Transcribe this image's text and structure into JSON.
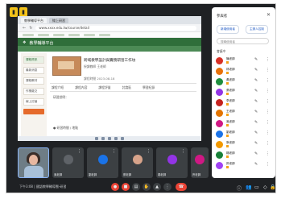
{
  "meet": {
    "bottom_left": "下午3:08 | 國語教學輔導團-研習",
    "controls": [
      "mic-off",
      "cam-off",
      "captions",
      "hand",
      "present",
      "more",
      "end-call"
    ],
    "right_icons": [
      "info",
      "people",
      "chat",
      "activities",
      "lock"
    ]
  },
  "browser": {
    "tabs": [
      "教學輔導平台",
      "線上研習"
    ],
    "url": "www.xxxx.edu.tw/course/detail"
  },
  "site": {
    "header": "教學輔導平台",
    "sidebar": [
      "課程資訊",
      "最新消息",
      "課程教材",
      "作業繳交",
      "線上討論"
    ],
    "course_title": "跨域教學設計與實務研習工作坊",
    "course_sub": "授課教師 王老師",
    "course_meta": "課程時間 2023-08-18",
    "tabs": [
      "課程介紹",
      "課程內容",
      "課程評量",
      "討論區",
      "學習紀錄"
    ],
    "line1": "研習說明：",
    "line2": "● 研習時間 / 地點"
  },
  "panel": {
    "title": "參與者",
    "add_people": "新增使用者",
    "host_controls": "主辦人控制",
    "search_placeholder": "搜尋使用者",
    "section": "會議中",
    "rows": [
      {
        "name": "陳老師",
        "color": "#d93025"
      },
      {
        "name": "林老師",
        "color": "#e8710a"
      },
      {
        "name": "黃老師",
        "color": "#1e8e3e"
      },
      {
        "name": "張老師",
        "color": "#9334e6"
      },
      {
        "name": "李老師",
        "color": "#c5221f"
      },
      {
        "name": "王老師",
        "color": "#e37400"
      },
      {
        "name": "吳老師",
        "color": "#d01884"
      },
      {
        "name": "劉老師",
        "color": "#1a73e8"
      },
      {
        "name": "蔡老師",
        "color": "#f29900"
      },
      {
        "name": "楊老師",
        "color": "#188038"
      },
      {
        "name": "許老師",
        "color": "#a142f4"
      }
    ]
  },
  "tiles": [
    {
      "name": "吳老師",
      "color": "#5f6368"
    },
    {
      "name": "劉老師",
      "color": "#1a73e8"
    },
    {
      "name": "蔡老師",
      "color": "#d7a38a"
    },
    {
      "name": "楊老師",
      "color": "#9334e6"
    },
    {
      "name": "許老師",
      "color": "#d01884"
    }
  ]
}
